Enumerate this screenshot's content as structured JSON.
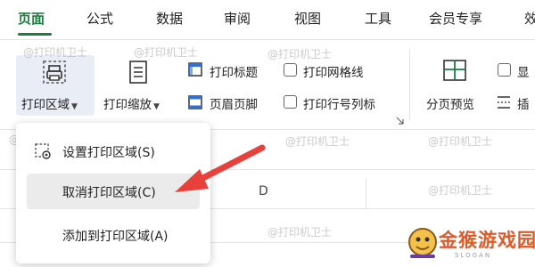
{
  "tabs": [
    "页面",
    "公式",
    "数据",
    "审阅",
    "视图",
    "工具",
    "会员专享",
    "效"
  ],
  "active_tab": "页面",
  "ribbon": {
    "print_area": "打印区域",
    "print_scale": "打印缩放",
    "print_titles": "打印标题",
    "header_footer": "页眉页脚",
    "print_gridlines": "打印网格线",
    "print_row_col_headers": "打印行号列标",
    "page_break_preview": "分页预览",
    "show_partial": "显",
    "insert_partial": "插"
  },
  "watermark": "@打印机卫士",
  "sheet": {
    "column_d": "D"
  },
  "menu": {
    "items": [
      "设置打印区域(S)",
      "取消打印区域(C)",
      "添加到打印区域(A)"
    ],
    "highlighted": "取消打印区域(C)"
  },
  "logo": {
    "text": "金猴游戏园",
    "sub": "SLOGAN"
  },
  "colors": {
    "accent": "#1a7f3c",
    "arrow": "#e8413c",
    "logo": "#e05a28"
  }
}
